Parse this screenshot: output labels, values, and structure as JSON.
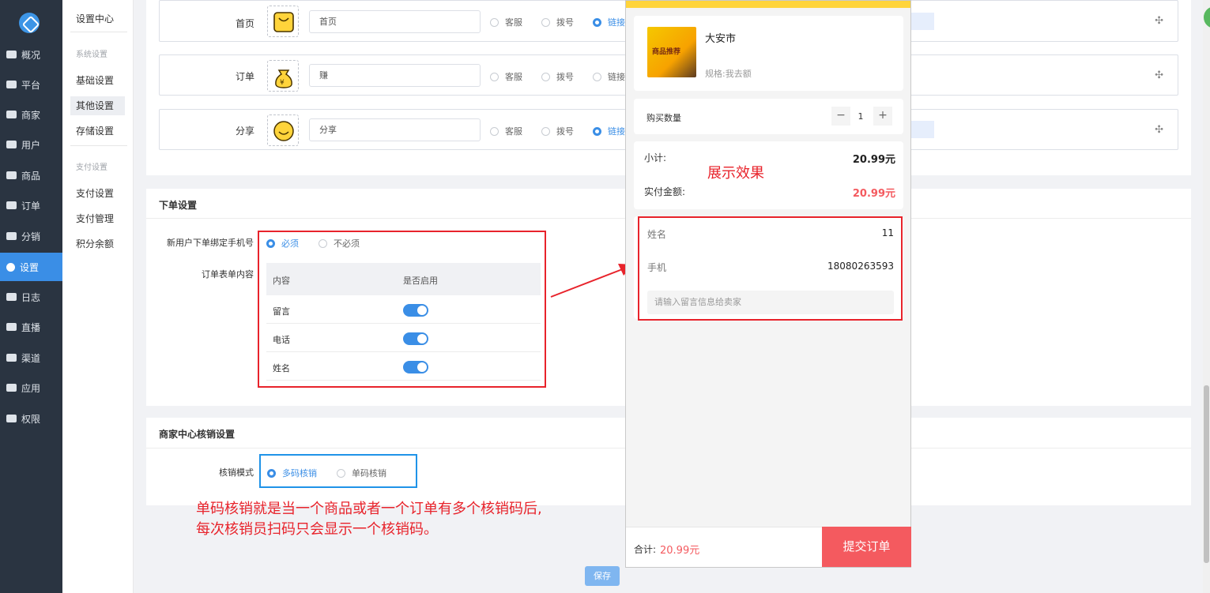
{
  "sidebar": {
    "items": [
      {
        "label": "概况",
        "icon": "chart-icon"
      },
      {
        "label": "平台",
        "icon": "monitor-icon"
      },
      {
        "label": "商家",
        "icon": "store-icon"
      },
      {
        "label": "用户",
        "icon": "user-icon"
      },
      {
        "label": "商品",
        "icon": "goods-icon"
      },
      {
        "label": "订单",
        "icon": "order-icon"
      },
      {
        "label": "分销",
        "icon": "distribution-icon"
      },
      {
        "label": "设置",
        "icon": "gear-icon"
      },
      {
        "label": "日志",
        "icon": "log-icon"
      },
      {
        "label": "直播",
        "icon": "live-icon"
      },
      {
        "label": "渠道",
        "icon": "channel-icon"
      },
      {
        "label": "应用",
        "icon": "apps-icon"
      },
      {
        "label": "权限",
        "icon": "lock-icon"
      }
    ]
  },
  "submenu": {
    "title": "设置中心",
    "group_system": "系统设置",
    "basic": "基础设置",
    "other": "其他设置",
    "storage": "存储设置",
    "group_pay": "支付设置",
    "pay_settings": "支付设置",
    "pay_manage": "支付管理",
    "points": "积分余额"
  },
  "nav_rows": [
    {
      "label": "首页",
      "input": "首页",
      "opt1": "客服",
      "opt2": "拨号",
      "opt3": "链接"
    },
    {
      "label": "订单",
      "input": "赚",
      "opt1": "客服",
      "opt2": "拨号",
      "opt3": "链接"
    },
    {
      "label": "分享",
      "input": "分享",
      "opt1": "客服",
      "opt2": "拨号",
      "opt3": "链接"
    }
  ],
  "order_settings": {
    "title": "下单设置",
    "bind_phone_label": "新用户下单绑定手机号",
    "required": "必须",
    "not_required": "不必须",
    "form_label": "订单表单内容",
    "col_content": "内容",
    "col_enabled": "是否启用",
    "rows": [
      "留言",
      "电话",
      "姓名"
    ]
  },
  "verify_settings": {
    "title": "商家中心核销设置",
    "mode_label": "核销模式",
    "multi": "多码核销",
    "single": "单码核销"
  },
  "save_label": "保存",
  "annotation": {
    "display_effect": "展示效果",
    "note_line1": "单码核销就是当一个商品或者一个订单有多个核销码后,",
    "note_line2": "每次核销员扫码只会显示一个核销码。"
  },
  "phone": {
    "shop_name": "大安市",
    "spec": "规格:我去额",
    "img_text": "商品推荐",
    "qty_label": "购买数量",
    "qty_value": "1",
    "minus": "−",
    "plus": "+",
    "subtotal_label": "小计:",
    "subtotal_value": "20.99元",
    "paid_label": "实付金额:",
    "paid_value": "20.99元",
    "name_label": "姓名",
    "name_value": "11",
    "phone_label": "手机",
    "phone_value": "18080263593",
    "message_placeholder": "请输入留言信息给卖家",
    "total_label": "合计:",
    "total_value": "20.99元",
    "submit": "提交订单"
  },
  "colors": {
    "accent": "#3a8ee6",
    "sidebar": "#2a3441",
    "annotation_red": "#e8232b",
    "price_red": "#f45a5f",
    "phone_header": "#ffd43b"
  }
}
